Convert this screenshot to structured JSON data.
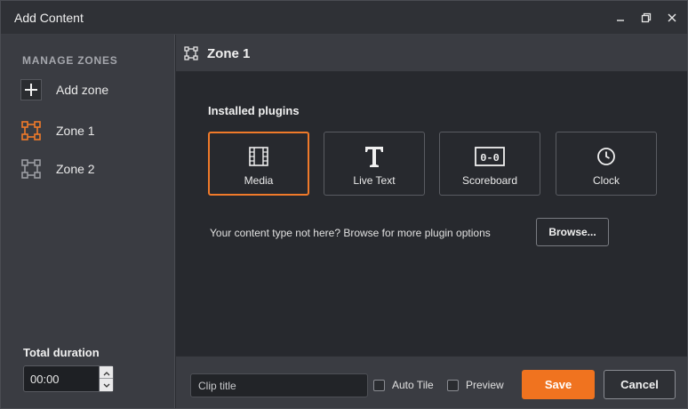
{
  "window": {
    "title": "Add Content",
    "controls": [
      "minimize-icon",
      "restore-icon",
      "close-icon"
    ]
  },
  "sidebar": {
    "section_title": "MANAGE ZONES",
    "items": [
      {
        "label": "Add zone",
        "icon": "plus-icon"
      },
      {
        "label": "Zone 1",
        "icon": "zone-icon",
        "active": true,
        "color": "#f07a2a"
      },
      {
        "label": "Zone 2",
        "icon": "zone-icon",
        "color": "#9a9ca2"
      }
    ],
    "duration": {
      "title": "Total duration",
      "value": "00:00"
    }
  },
  "main": {
    "zone_title": "Zone 1",
    "plugins_title": "Installed plugins",
    "plugins": [
      {
        "label": "Media",
        "icon": "film-icon",
        "selected": true
      },
      {
        "label": "Live Text",
        "icon": "text-icon"
      },
      {
        "label": "Scoreboard",
        "icon": "scoreboard-icon",
        "glyph": "0-0"
      },
      {
        "label": "Clock",
        "icon": "clock-icon"
      }
    ],
    "browse_text": "Your content type not here? Browse for more plugin options",
    "browse_button": "Browse..."
  },
  "footer": {
    "clip_placeholder": "Clip title",
    "auto_tile_label": "Auto Tile",
    "preview_label": "Preview",
    "save_label": "Save",
    "cancel_label": "Cancel"
  },
  "colors": {
    "accent": "#f07a2a",
    "save_button": "#f0731f"
  }
}
